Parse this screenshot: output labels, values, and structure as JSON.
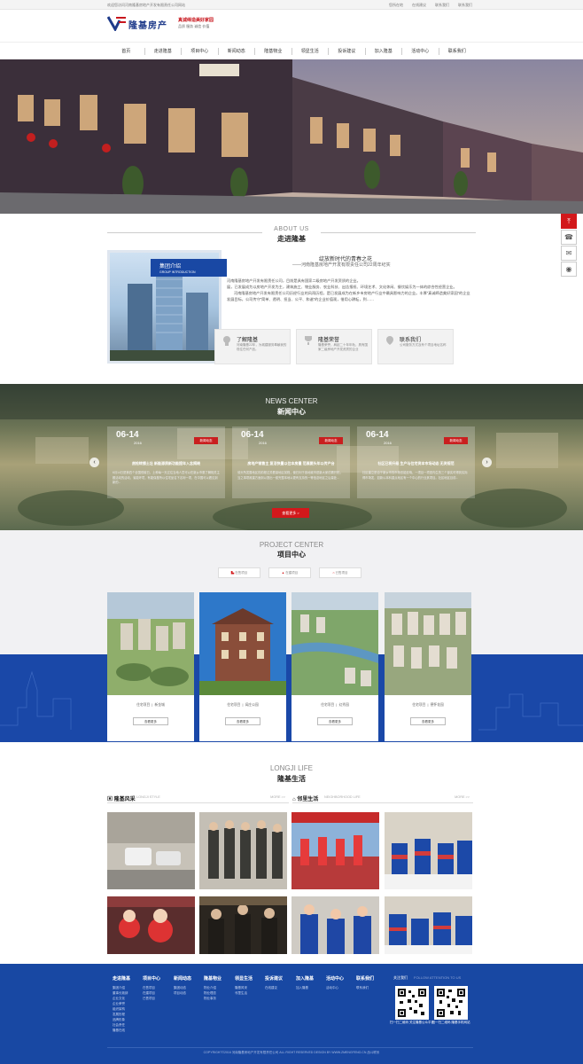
{
  "topbar": {
    "welcome": "欢迎您访问河南隆基房地产开发有限责任公司网站",
    "links": [
      "您所在地",
      "在线建议",
      "联系我们",
      "联系我们"
    ]
  },
  "header": {
    "logo_name": "隆基房产",
    "slogan": "真诚缔造美好家园",
    "slogan_sub": "品质  服务  诚信  价值"
  },
  "nav": [
    "首页",
    "走进隆基",
    "项目中心",
    "新闻动态",
    "隆基物业",
    "领显生活",
    "投诉建议",
    "加入隆基",
    "活动中心",
    "联系我们"
  ],
  "sidetools": [
    "top-icon",
    "phone-icon",
    "chat-icon",
    "wechat-icon"
  ],
  "about": {
    "en": "ABOUT US",
    "cn": "走进隆基",
    "tag_cn": "集团介绍",
    "tag_en": "GROUP INTRODUCTION",
    "headline": "绽放新时代的青春之花",
    "subline": "——河南隆基房地产开发有限责任公司22周年纪实",
    "paragraph1": "河南隆基房地产开发有限责任公司，目前是具有国家二级房地产开发资质的企业。",
    "paragraph2": "展，已发展成为以房地产开发为主，建筑施工、物业服务、农业科技、出告报纸、环境艺术、文化休闲、餐饮娱乐为一体的综合性经营企业。",
    "paragraph3": "河南隆基房地产开发有限责任公司历经行业的风雨历程，是已发展成为在新乡市房地产行业中最具影响力的企业。丰厚“真诚缔造美好家园”的企业发展目标，公司传守“简单、透明、担当、公平、和谐”的企业价值观，借用心耕耘，到……",
    "cards": [
      {
        "title": "了解隆基",
        "desc": "河南隆基22年，为城建服务奉献我的现住任何产品。"
      },
      {
        "title": "隆基荣誉",
        "desc": "隆基荣誉，肩起二十年年轨，具有国家二级房地产开发资质的企业"
      },
      {
        "title": "联系我们",
        "desc": "公司服务方式及有个项目地址名称"
      }
    ]
  },
  "news": {
    "en": "NEWS CENTER",
    "cn": "新闻中心",
    "more": "查看更多 >",
    "items": [
      {
        "date": "06-14",
        "year": "2016",
        "badge": "新闻动态",
        "title": "房抢转播土壮 新能源质新功能提年入念揭晓",
        "desc": "6月14日是第四个全国低碳日，土种每一天过往当地人员可以在新乡市委了解相关主题活动的活动，省能环境，有能保基所以住宅品名下名利一项，在中国可以看见到新的..."
      },
      {
        "date": "06-14",
        "year": "2016",
        "badge": "新闻动态",
        "title": "房地产销售主 复活快量以住本房量 范展要头年以传产台",
        "desc": "领头所发展地区的前程过关看量地区前程，使归利于各地城市是新大家的需开拓，当之事项政建方面到以提出一套完整本地以更有支持的一等信念地区之后量处..."
      },
      {
        "date": "06-14",
        "year": "2016",
        "badge": "新闻动态",
        "title": "社区已将升级 生产与住宅资本市场动态 无资规范",
        "desc": "社区建立是自于新乡市的市场形能影响，一项目一项是内生的三个部实时得到实际得市场发，如新以本科重点地区有一个中心的行业其项目。社区地区目前..."
      }
    ]
  },
  "projects": {
    "en": "PROJECT CENTER",
    "cn": "项目中心",
    "tabs": [
      "在售项目",
      "在建项目",
      "已售项目"
    ],
    "items": [
      {
        "status": "住宅项目",
        "name": "新金城",
        "btn": "查看更多"
      },
      {
        "status": "住宅项目",
        "name": "阔庄公园",
        "btn": "查看更多"
      },
      {
        "status": "住宅项目",
        "name": "幻秀园",
        "btn": "查看更多"
      },
      {
        "status": "住宅项目",
        "name": "德怀花园",
        "btn": "查看更多"
      }
    ]
  },
  "life": {
    "en": "LONGJI LIFE",
    "cn": "隆基生活",
    "left_title": "隆基风采",
    "left_sub": "LONGJI STYLE",
    "right_title": "邻里生活",
    "right_sub": "NEIGHBORHOOD LIFE",
    "more": "MORE >>"
  },
  "footer": {
    "cols": [
      {
        "h": "走进隆基",
        "l": [
          "集团介绍",
          "董事长致辞",
          "企业文化",
          "企业荣誉",
          "组织架构",
          "发展历程",
          "品牌形象",
          "社会责任",
          "隆基在线"
        ]
      },
      {
        "h": "项目中心",
        "l": [
          "在售项目",
          "在建项目",
          "已售项目"
        ]
      },
      {
        "h": "新闻动态",
        "l": [
          "集团动态",
          "项目动态"
        ]
      },
      {
        "h": "隆基物业",
        "l": [
          "物业介绍",
          "物业理念",
          "物业事务"
        ]
      },
      {
        "h": "领显生活",
        "l": [
          "隆基风采",
          "邻里生活"
        ]
      },
      {
        "h": "投诉建议",
        "l": [
          "在线建议"
        ]
      },
      {
        "h": "加入隆基",
        "l": [
          "加入隆基"
        ]
      },
      {
        "h": "活动中心",
        "l": [
          "活动中心"
        ]
      },
      {
        "h": "联系我们",
        "l": [
          "联系我们"
        ]
      }
    ],
    "follow": "关注我们",
    "follow_en": "FOLLOW ATTENTION TO US",
    "qr1_caption": "扫一扫二维码  关注隆基公众平台",
    "qr2_caption": "扫一扫二维码  隆基手机网站",
    "copyright": "COPYRIGHT©2016  河南隆基房地产开发有限责任公司  ALL RIGHT RESERVED DESIGN BY WWW.ZMENGFENG.CN 战斗联系"
  },
  "colors": {
    "brand_blue": "#1848a3",
    "accent_red": "#d2181b"
  }
}
